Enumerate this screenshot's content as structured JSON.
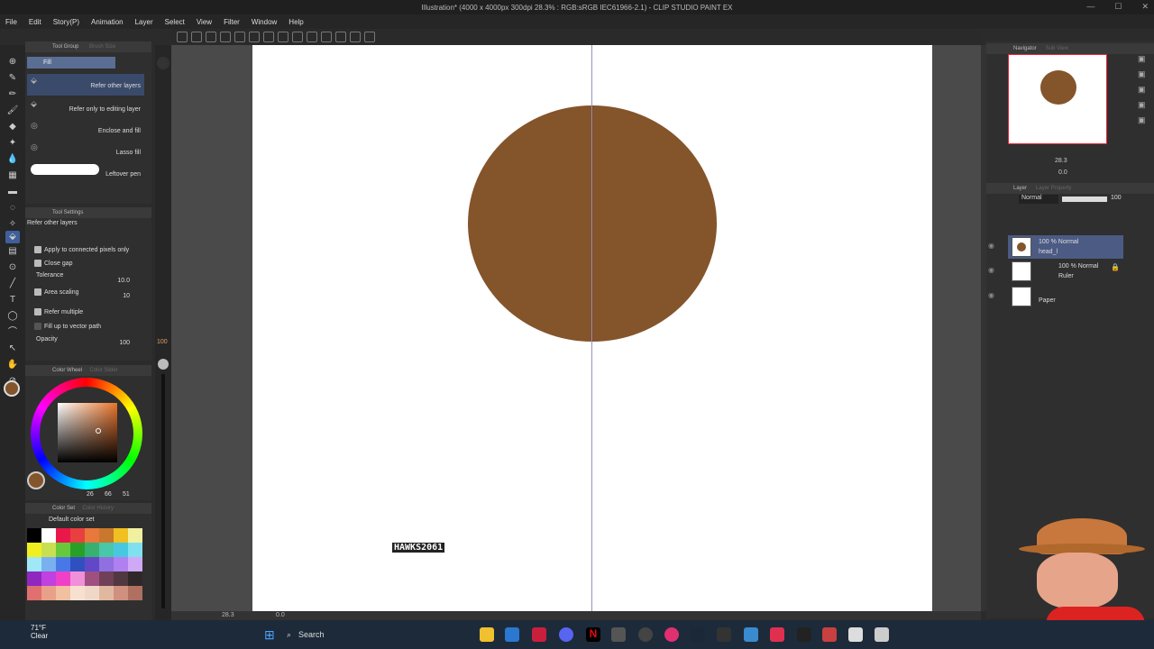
{
  "titlebar": {
    "title": "Illustration* (4000 x 4000px 300dpi 28.3%  :  RGB:sRGB IEC61966-2.1)  -  CLIP STUDIO PAINT EX"
  },
  "menu": [
    "File",
    "Edit",
    "Story(P)",
    "Animation",
    "Layer",
    "Select",
    "View",
    "Filter",
    "Window",
    "Help"
  ],
  "toolgroup": {
    "tab": "Tool Group",
    "tab2": "Brush Size",
    "current": "Fill",
    "subtools": [
      "Refer other layers",
      "Refer only to editing layer",
      "Enclose and fill",
      "Lasso fill",
      "Leftover pen"
    ]
  },
  "toolsettings": {
    "tab": "Tool Settings",
    "title": "Refer other layers",
    "rows": {
      "apply": "Apply to connected pixels only",
      "closegap": "Close gap",
      "tolerance": "Tolerance",
      "tolerance_val": "10.0",
      "area": "Area scaling",
      "area_val": "10",
      "refer": "Refer multiple",
      "fillup": "Fill up to vector path",
      "opacity": "Opacity",
      "opacity_val": "100"
    }
  },
  "brushsize": {
    "value": "100"
  },
  "colorwheel": {
    "tab": "Color Wheel",
    "tab2": "Color Slider",
    "h": "26",
    "s": "66",
    "v": "51",
    "current_color": "#84542b"
  },
  "colorset": {
    "tab": "Color Set",
    "tab2": "Color History",
    "name": "Default color set",
    "swatches": [
      "#000000",
      "#ffffff",
      "#e8194a",
      "#e84040",
      "#e8783c",
      "#c8782c",
      "#f0c020",
      "#f0f0a0",
      "#f0f020",
      "#c8e050",
      "#68c83c",
      "#28a028",
      "#38b070",
      "#48c8a8",
      "#48c8e0",
      "#80e0f0",
      "#a0e8f8",
      "#78b0f0",
      "#4878e8",
      "#3050c0",
      "#6048c8",
      "#9070e0",
      "#b080f0",
      "#d0a8f8",
      "#9028c0",
      "#c040e0",
      "#f040c8",
      "#f090d8",
      "#a05080",
      "#704058",
      "#503840",
      "#302828",
      "#e07070",
      "#e8a088",
      "#f0c0a0",
      "#f8e0d0",
      "#f0d8c8",
      "#e0b8a0",
      "#d09080",
      "#b07060"
    ]
  },
  "canvas": {
    "watermark": "HAWKS2061",
    "zoom": "28.3",
    "angle": "0.0"
  },
  "navigator": {
    "tab": "Navigator",
    "tab2": "Sub View",
    "zoom": "28.3",
    "angle": "0.0"
  },
  "layerpanel": {
    "tab": "Layer",
    "tab2": "Layer Property",
    "blend": "Normal",
    "opacity": "100",
    "layers": [
      {
        "line1": "100 % Normal",
        "line2": "head_l",
        "selected": true
      },
      {
        "line1": "100 % Normal",
        "line2": "Ruler",
        "selected": false
      },
      {
        "line1": "",
        "line2": "Paper",
        "selected": false
      }
    ]
  },
  "taskbar": {
    "temp": "71°F",
    "weather": "Clear",
    "search": "Search"
  }
}
